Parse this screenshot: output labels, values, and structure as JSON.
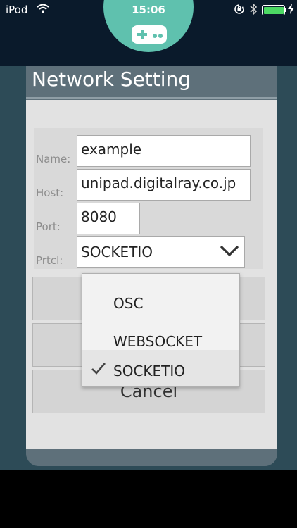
{
  "status_bar": {
    "carrier": "iPod",
    "time": "15:06"
  },
  "icons": {
    "gamepad": "gamepad-icon",
    "wifi": "wifi-icon",
    "orientation_lock": "orientation-lock-icon",
    "bluetooth": "bluetooth-icon",
    "battery": "battery-icon",
    "charging": "charging-icon",
    "dropdown_chevron": "chevron-down-icon",
    "check": "checkmark-icon"
  },
  "colors": {
    "accent": "#5fc1ae",
    "header": "#5e707a",
    "backdrop": "#2d4b57",
    "battery": "#4cd964"
  },
  "panel": {
    "title": "Network Setting"
  },
  "form": {
    "name_label": "Name:",
    "name_value": "example",
    "host_label": "Host:",
    "host_value": "unipad.digitalray.co.jp",
    "port_label": "Port:",
    "port_value": "8080",
    "protocol_label": "Prtcl:",
    "protocol_value": "SOCKETIO"
  },
  "dropdown": {
    "options": [
      {
        "label": "OSC",
        "selected": false
      },
      {
        "label": "WEBSOCKET",
        "selected": false
      },
      {
        "label": "SOCKETIO",
        "selected": true
      }
    ]
  },
  "buttons": {
    "cancel": "Cancel"
  }
}
